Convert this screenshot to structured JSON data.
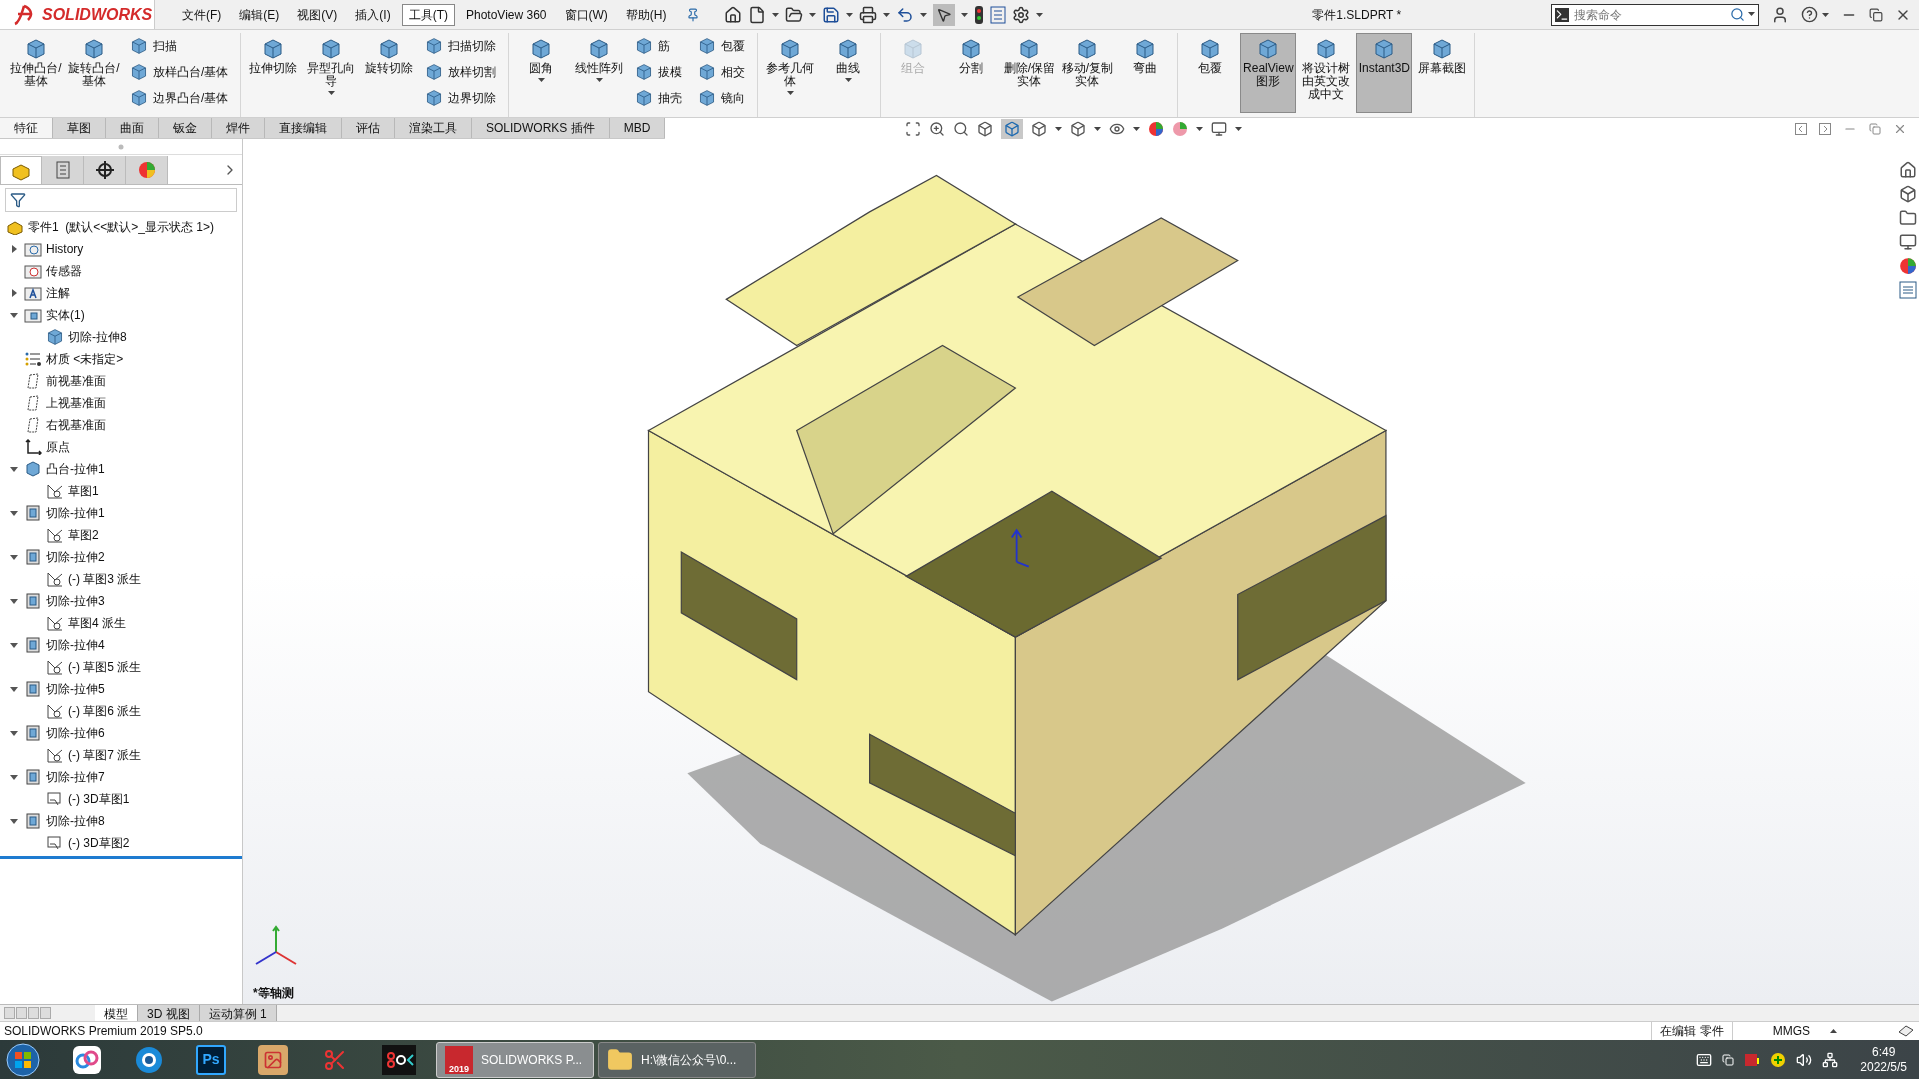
{
  "title_bar": {
    "logo": "SOLIDWORKS",
    "menus": [
      {
        "label": "文件(F)",
        "selected": false
      },
      {
        "label": "编辑(E)",
        "selected": false
      },
      {
        "label": "视图(V)",
        "selected": false
      },
      {
        "label": "插入(I)",
        "selected": false
      },
      {
        "label": "工具(T)",
        "selected": true
      },
      {
        "label": "PhotoView 360",
        "selected": false
      },
      {
        "label": "窗口(W)",
        "selected": false
      },
      {
        "label": "帮助(H)",
        "selected": false
      }
    ],
    "document_title": "零件1.SLDPRT *",
    "search": {
      "placeholder": "搜索命令"
    }
  },
  "ribbon": {
    "groups": [
      {
        "items": [
          {
            "kind": "large",
            "label": "拉伸凸台/基体",
            "dropdown": false,
            "pressed": false,
            "disabled": false
          },
          {
            "kind": "large",
            "label": "旋转凸台/基体",
            "dropdown": false,
            "pressed": false,
            "disabled": false
          },
          {
            "kind": "stack",
            "items": [
              {
                "label": "扫描"
              },
              {
                "label": "放样凸台/基体"
              },
              {
                "label": "边界凸台/基体"
              }
            ]
          }
        ]
      },
      {
        "items": [
          {
            "kind": "large",
            "label": "拉伸切除",
            "dropdown": false,
            "pressed": false,
            "disabled": false
          },
          {
            "kind": "large",
            "label": "异型孔向导",
            "dropdown": true,
            "pressed": false,
            "disabled": false
          },
          {
            "kind": "large",
            "label": "旋转切除",
            "dropdown": false,
            "pressed": false,
            "disabled": false
          },
          {
            "kind": "stack",
            "items": [
              {
                "label": "扫描切除"
              },
              {
                "label": "放样切割"
              },
              {
                "label": "边界切除"
              }
            ]
          }
        ]
      },
      {
        "items": [
          {
            "kind": "large",
            "label": "圆角",
            "dropdown": true,
            "pressed": false,
            "disabled": false
          },
          {
            "kind": "large",
            "label": "线性阵列",
            "dropdown": true,
            "pressed": false,
            "disabled": false
          },
          {
            "kind": "stack",
            "items": [
              {
                "label": "筋"
              },
              {
                "label": "拔模"
              },
              {
                "label": "抽壳"
              }
            ]
          },
          {
            "kind": "stack",
            "items": [
              {
                "label": "包覆"
              },
              {
                "label": "相交"
              },
              {
                "label": "镜向"
              }
            ]
          }
        ]
      },
      {
        "items": [
          {
            "kind": "large",
            "label": "参考几何体",
            "dropdown": true,
            "pressed": false,
            "disabled": false
          },
          {
            "kind": "large",
            "label": "曲线",
            "dropdown": true,
            "pressed": false,
            "disabled": false
          }
        ]
      },
      {
        "items": [
          {
            "kind": "large",
            "label": "组合",
            "dropdown": false,
            "pressed": false,
            "disabled": true
          },
          {
            "kind": "large",
            "label": "分割",
            "dropdown": false,
            "pressed": false,
            "disabled": false
          },
          {
            "kind": "large",
            "label": "删除/保留实体",
            "dropdown": false,
            "pressed": false,
            "disabled": false
          },
          {
            "kind": "large",
            "label": "移动/复制实体",
            "dropdown": false,
            "pressed": false,
            "disabled": false
          },
          {
            "kind": "large",
            "label": "弯曲",
            "dropdown": false,
            "pressed": false,
            "disabled": false
          }
        ]
      },
      {
        "items": [
          {
            "kind": "large",
            "label": "包覆",
            "dropdown": false,
            "pressed": false,
            "disabled": false
          },
          {
            "kind": "large",
            "label": "RealView图形",
            "dropdown": false,
            "pressed": true,
            "disabled": false
          },
          {
            "kind": "large",
            "label": "将设计树由英文改成中文",
            "dropdown": false,
            "pressed": false,
            "disabled": false
          },
          {
            "kind": "large",
            "label": "Instant3D",
            "dropdown": false,
            "pressed": true,
            "disabled": false
          },
          {
            "kind": "large",
            "label": "屏幕截图",
            "dropdown": false,
            "pressed": false,
            "disabled": false
          }
        ]
      }
    ]
  },
  "command_tabs": [
    {
      "label": "特征",
      "selected": true
    },
    {
      "label": "草图",
      "selected": false
    },
    {
      "label": "曲面",
      "selected": false
    },
    {
      "label": "钣金",
      "selected": false
    },
    {
      "label": "焊件",
      "selected": false
    },
    {
      "label": "直接编辑",
      "selected": false
    },
    {
      "label": "评估",
      "selected": false
    },
    {
      "label": "渲染工具",
      "selected": false
    },
    {
      "label": "SOLIDWORKS 插件",
      "selected": false
    },
    {
      "label": "MBD",
      "selected": false
    }
  ],
  "tree": {
    "root": {
      "label": "零件1  (默认<<默认>_显示状态 1>)"
    },
    "items": [
      {
        "kind": "history",
        "label": "History",
        "expanded": false
      },
      {
        "kind": "sensor",
        "label": "传感器"
      },
      {
        "kind": "annotation",
        "label": "注解",
        "expanded": false
      },
      {
        "kind": "solid",
        "label": "实体(1)",
        "expanded": true,
        "children": [
          {
            "kind": "body",
            "label": "切除-拉伸8"
          }
        ]
      },
      {
        "kind": "material",
        "label": "材质 <未指定>"
      },
      {
        "kind": "plane",
        "label": "前视基准面"
      },
      {
        "kind": "plane",
        "label": "上视基准面"
      },
      {
        "kind": "plane",
        "label": "右视基准面"
      },
      {
        "kind": "origin",
        "label": "原点"
      },
      {
        "kind": "boss",
        "label": "凸台-拉伸1",
        "expanded": true,
        "children": [
          {
            "kind": "sketch",
            "label": "草图1"
          }
        ]
      },
      {
        "kind": "cut",
        "label": "切除-拉伸1",
        "expanded": true,
        "children": [
          {
            "kind": "sketch",
            "label": "草图2"
          }
        ]
      },
      {
        "kind": "cut",
        "label": "切除-拉伸2",
        "expanded": true,
        "children": [
          {
            "kind": "sketch",
            "label": "(-) 草图3 派生"
          }
        ]
      },
      {
        "kind": "cut",
        "label": "切除-拉伸3",
        "expanded": true,
        "children": [
          {
            "kind": "sketch",
            "label": "草图4 派生"
          }
        ]
      },
      {
        "kind": "cut",
        "label": "切除-拉伸4",
        "expanded": true,
        "children": [
          {
            "kind": "sketch",
            "label": "(-) 草图5 派生"
          }
        ]
      },
      {
        "kind": "cut",
        "label": "切除-拉伸5",
        "expanded": true,
        "children": [
          {
            "kind": "sketch",
            "label": "(-) 草图6 派生"
          }
        ]
      },
      {
        "kind": "cut",
        "label": "切除-拉伸6",
        "expanded": true,
        "children": [
          {
            "kind": "sketch",
            "label": "(-) 草图7 派生"
          }
        ]
      },
      {
        "kind": "cut",
        "label": "切除-拉伸7",
        "expanded": true,
        "children": [
          {
            "kind": "sketch3d",
            "label": "(-) 3D草图1"
          }
        ]
      },
      {
        "kind": "cut",
        "label": "切除-拉伸8",
        "expanded": true,
        "children": [
          {
            "kind": "sketch3d",
            "label": "(-) 3D草图2"
          }
        ]
      }
    ]
  },
  "viewport": {
    "view_label": "*等轴测"
  },
  "model_tabs": [
    {
      "label": "模型",
      "selected": true
    },
    {
      "label": "3D 视图",
      "selected": false
    },
    {
      "label": "运动算例 1",
      "selected": false
    }
  ],
  "status_bar": {
    "product": "SOLIDWORKS Premium 2019 SP5.0",
    "mode": "在编辑 零件",
    "units": "MMGS"
  },
  "taskbar": {
    "pinned": [
      {
        "kind": "cloud"
      },
      {
        "kind": "aperture"
      },
      {
        "kind": "ps",
        "glyph": "Ps"
      },
      {
        "kind": "photo"
      },
      {
        "kind": "scissors"
      },
      {
        "kind": "record"
      }
    ],
    "tasks": [
      {
        "kind": "sw",
        "badge": "2019",
        "label": "SOLIDWORKS P...",
        "selected": true
      },
      {
        "kind": "folder",
        "label": "H:\\微信公众号\\0...",
        "selected": false
      }
    ],
    "clock": {
      "time": "6:49",
      "date": "2022/5/5"
    }
  }
}
